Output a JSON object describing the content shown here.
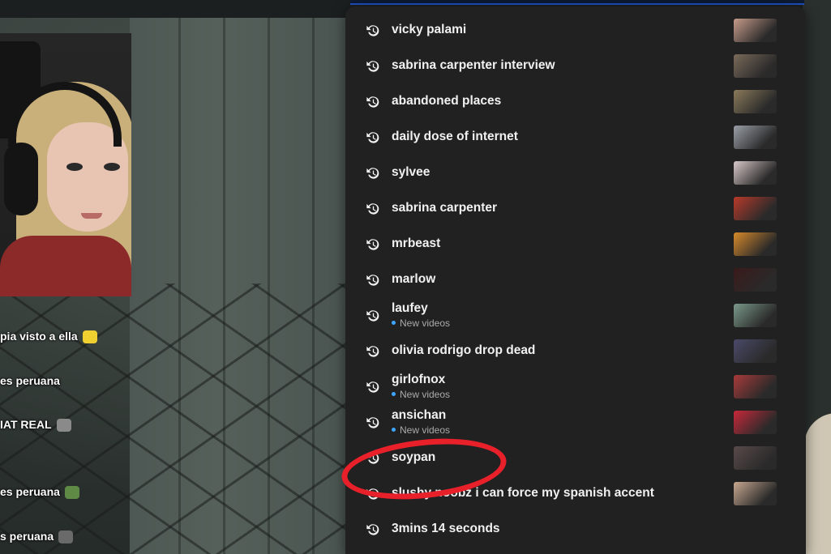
{
  "chat": [
    {
      "text": "pia visto a ella",
      "emote_color": "#f0d030"
    },
    {
      "text": "es peruana",
      "emote_color": ""
    },
    {
      "text": "IAT REAL",
      "emote_color": "#8a8a8a"
    },
    {
      "text": "es peruana",
      "emote_color": "#5f8a45"
    },
    {
      "text": "s peruana",
      "emote_color": "#6a6a6a"
    }
  ],
  "search_history": {
    "items": [
      {
        "label": "vicky palami",
        "sub": "",
        "thumb": "#c79b8a"
      },
      {
        "label": "sabrina carpenter interview",
        "sub": "",
        "thumb": "#7a6a5a"
      },
      {
        "label": "abandoned places",
        "sub": "",
        "thumb": "#8a7a5a"
      },
      {
        "label": "daily dose of internet",
        "sub": "",
        "thumb": "#9aa0a8"
      },
      {
        "label": "sylvee",
        "sub": "",
        "thumb": "#d8c8c8"
      },
      {
        "label": "sabrina carpenter",
        "sub": "",
        "thumb": "#b83a2a"
      },
      {
        "label": "mrbeast",
        "sub": "",
        "thumb": "#d88a2a"
      },
      {
        "label": "marlow",
        "sub": "",
        "thumb": "#3a1a1a"
      },
      {
        "label": "laufey",
        "sub": "New videos",
        "thumb": "#7a9a8a"
      },
      {
        "label": "olivia rodrigo drop dead",
        "sub": "",
        "thumb": "#4a4a6a"
      },
      {
        "label": "girlofnox",
        "sub": "New videos",
        "thumb": "#a83a3a"
      },
      {
        "label": "ansichan",
        "sub": "New videos",
        "thumb": "#c8283a"
      },
      {
        "label": "soypan",
        "sub": "",
        "thumb": "#5a4a4a"
      },
      {
        "label": "slushy noobz i can force my spanish accent",
        "sub": "",
        "thumb": "#c8a890"
      },
      {
        "label": "3mins 14 seconds",
        "sub": "",
        "thumb": ""
      }
    ]
  },
  "colors": {
    "dropdown_bg": "#212121",
    "text": "#f1f1f1",
    "new_dot": "#3ea6ff",
    "annotation": "#e8202a"
  },
  "icons": {
    "history": "history-icon"
  }
}
